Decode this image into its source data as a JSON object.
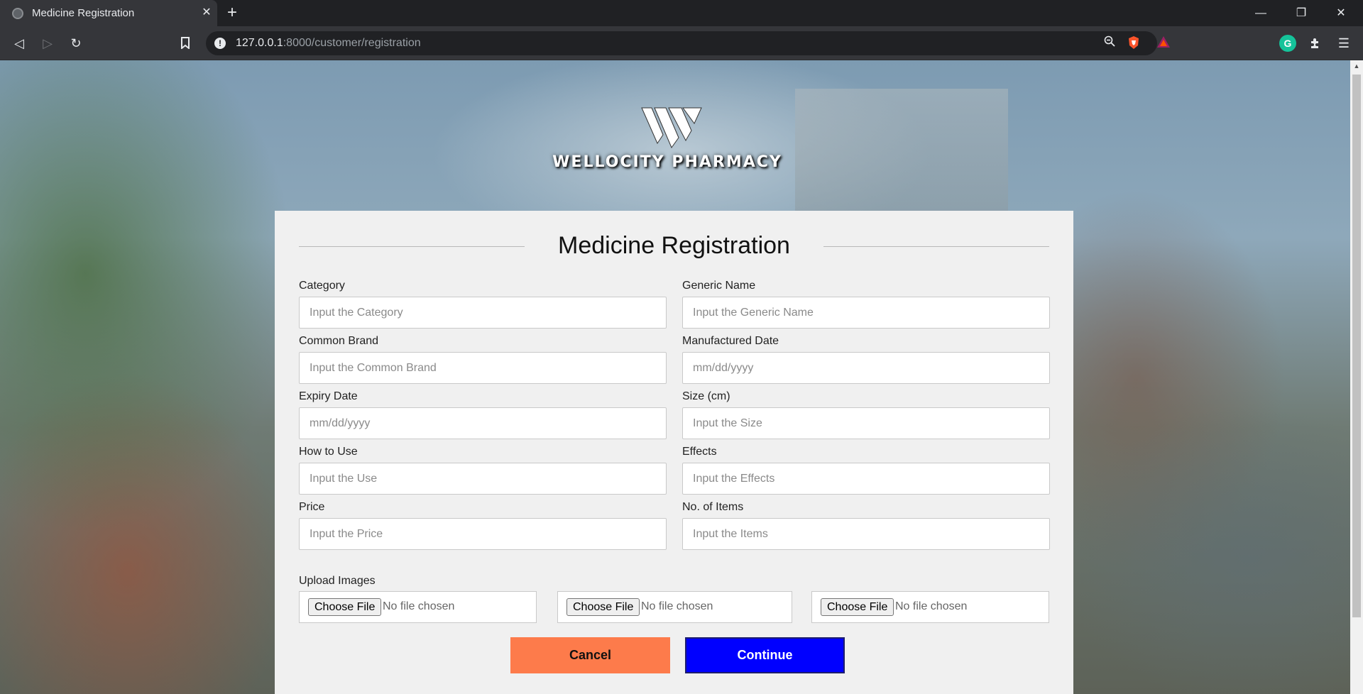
{
  "browser": {
    "tab_title": "Medicine Registration",
    "tab_close": "✕",
    "new_tab": "+",
    "url_host": "127.0.0.1",
    "url_path": ":8000/customer/registration",
    "window_controls": {
      "minimize": "—",
      "restore": "❐",
      "close": "✕"
    }
  },
  "brand": {
    "name": "WELLOCITY PHARMACY"
  },
  "form": {
    "title": "Medicine Registration",
    "fields": [
      {
        "label": "Category",
        "placeholder": "Input the Category"
      },
      {
        "label": "Generic Name",
        "placeholder": "Input the Generic Name"
      },
      {
        "label": "Common Brand",
        "placeholder": "Input the Common Brand"
      },
      {
        "label": "Manufactured Date",
        "placeholder": "mm/dd/yyyy"
      },
      {
        "label": "Expiry Date",
        "placeholder": "mm/dd/yyyy"
      },
      {
        "label": "Size (cm)",
        "placeholder": "Input the Size"
      },
      {
        "label": "How to Use",
        "placeholder": "Input the Use"
      },
      {
        "label": "Effects",
        "placeholder": "Input the Effects"
      },
      {
        "label": "Price",
        "placeholder": "Input the Price"
      },
      {
        "label": "No. of Items",
        "placeholder": "Input the Items"
      }
    ],
    "upload_label": "Upload Images",
    "uploads": [
      {
        "button": "Choose File",
        "status": "No file chosen"
      },
      {
        "button": "Choose File",
        "status": "No file chosen"
      },
      {
        "button": "Choose File",
        "status": "No file chosen"
      }
    ],
    "cancel_label": "Cancel",
    "continue_label": "Continue"
  },
  "colors": {
    "cancel": "#fd7b4b",
    "continue": "#0000ff",
    "card_bg": "#f0f0f0"
  }
}
